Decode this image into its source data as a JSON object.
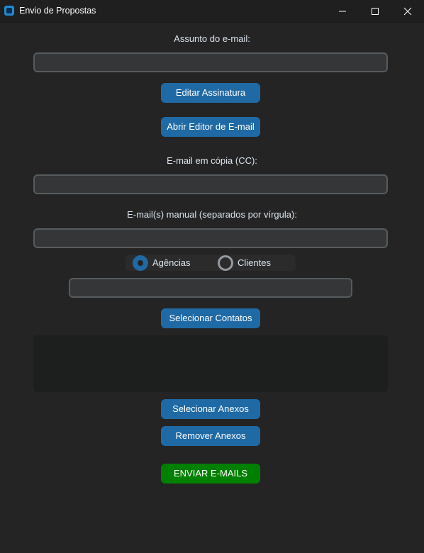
{
  "window": {
    "title": "Envio de Propostas"
  },
  "colors": {
    "background": "#242424",
    "button": "#1f6aa5",
    "send_button": "#008000",
    "entry_bg": "#343638",
    "entry_border": "#565b5e"
  },
  "subject": {
    "label": "Assunto do e-mail:",
    "value": ""
  },
  "buttons": {
    "edit_signature": "Editar Assinatura",
    "open_editor": "Abrir Editor de E-mail",
    "select_contacts": "Selecionar Contatos",
    "select_attachments": "Selecionar Anexos",
    "remove_attachments": "Remover Anexos",
    "send": "ENVIAR E-MAILS"
  },
  "cc": {
    "label": "E-mail em cópia (CC):",
    "value": ""
  },
  "manual": {
    "label": "E-mail(s) manual (separados por vírgula):",
    "value": ""
  },
  "recipient_type": {
    "options": [
      "Agências",
      "Clientes"
    ],
    "selected": "Agências"
  },
  "filter": {
    "value": ""
  },
  "attachments_list": []
}
